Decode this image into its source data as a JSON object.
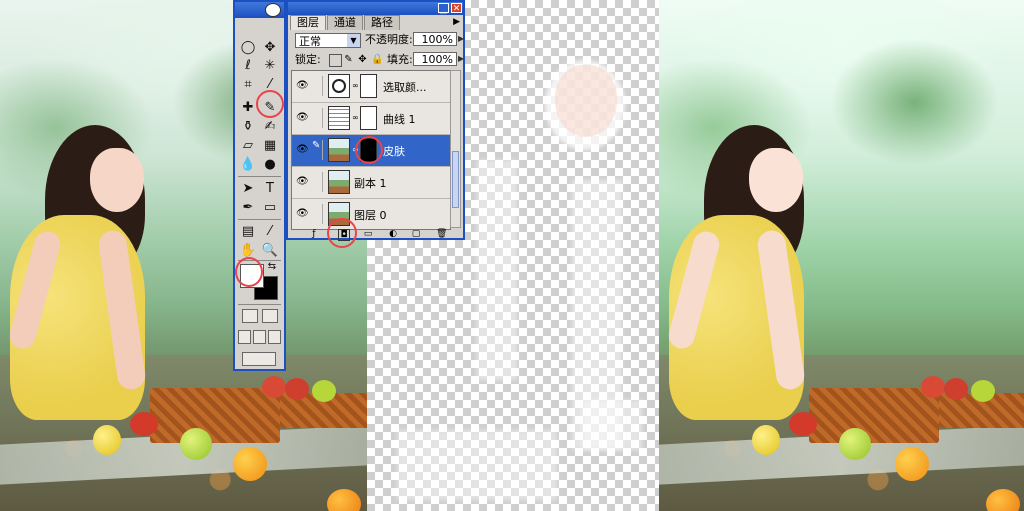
{
  "layers_panel": {
    "tabs": [
      "图层",
      "通道",
      "路径"
    ],
    "active_tab": "图层",
    "blend_mode": "正常",
    "opacity_label": "不透明度:",
    "opacity_value": "100%",
    "lock_label": "锁定:",
    "fill_label": "填充:",
    "fill_value": "100%",
    "layers": [
      {
        "name": "选取颜...",
        "type": "adjustment",
        "visible": true,
        "selected": false
      },
      {
        "name": "曲线 1",
        "type": "adjustment",
        "visible": true,
        "selected": false
      },
      {
        "name": "皮肤",
        "type": "image_with_mask",
        "visible": true,
        "selected": true
      },
      {
        "name": "副本 1",
        "type": "image",
        "visible": true,
        "selected": false
      },
      {
        "name": "图层 0",
        "type": "image",
        "visible": true,
        "selected": false
      }
    ]
  },
  "toolbox": {
    "foreground_color": "#ffffff",
    "background_color": "#000000"
  },
  "highlight_color": "#e8444a"
}
